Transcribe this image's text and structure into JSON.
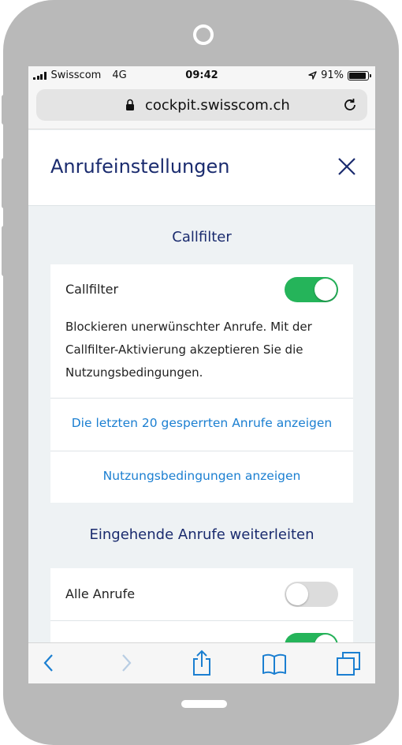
{
  "status_bar": {
    "carrier": "Swisscom",
    "network": "4G",
    "time": "09:42",
    "battery": "91%",
    "battery_level": 0.91
  },
  "browser": {
    "url": "cockpit.swisscom.ch"
  },
  "header": {
    "title": "Anrufeinstellungen"
  },
  "callfilter_section": {
    "title": "Callfilter",
    "toggle_label": "Callfilter",
    "toggle_on": true,
    "description": "Blockieren unerwünschter Anrufe. Mit der Callfilter-Aktivierung akzeptieren Sie die Nutzungsbedingungen.",
    "link_blocked_calls": "Die letzten 20 gesperrten Anrufe anzeigen",
    "link_terms": "Nutzungsbedingungen anzeigen"
  },
  "forwarding_section": {
    "title": "Eingehende Anrufe weiterleiten",
    "all_calls_label": "Alle Anrufe",
    "all_calls_on": false,
    "second_row_on": true
  },
  "colors": {
    "accent": "#1b7fd1",
    "title": "#1a2b6e",
    "toggle_on": "#25b45a",
    "background": "#eef2f4"
  }
}
